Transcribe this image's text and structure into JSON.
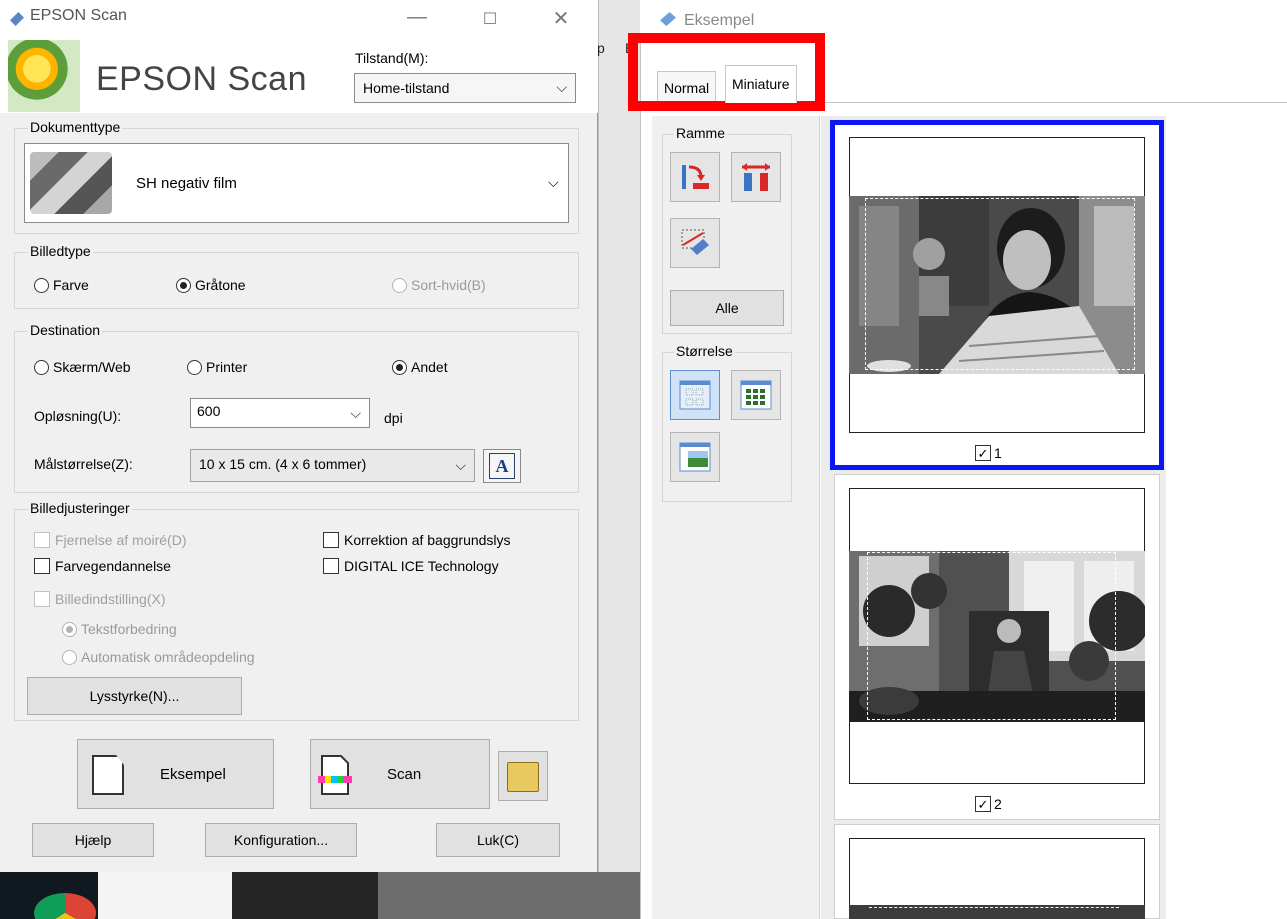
{
  "scan_window": {
    "title": "EPSON Scan",
    "logo_text": "EPSON Scan",
    "mode_label": "Tilstand(M):",
    "mode_value": "Home-tilstand",
    "document_type": {
      "group_title": "Dokumenttype",
      "value": "SH negativ film"
    },
    "image_type": {
      "group_title": "Billedtype",
      "options": [
        "Farve",
        "Gråtone",
        "Sort-hvid(B)"
      ],
      "selected": "Gråtone"
    },
    "destination": {
      "group_title": "Destination",
      "options": [
        "Skærm/Web",
        "Printer",
        "Andet"
      ],
      "selected": "Andet",
      "resolution_label": "Opløsning(U):",
      "resolution_value": "600",
      "resolution_unit": "dpi",
      "target_size_label": "Målstørrelse(Z):",
      "target_size_value": "10 x 15 cm. (4 x 6 tommer)"
    },
    "adjustments": {
      "group_title": "Billedjusteringer",
      "descreening": "Fjernelse af moiré(D)",
      "backlight_correction": "Korrektion af baggrundslys",
      "color_restoration": "Farvegendannelse",
      "digital_ice": "DIGITAL ICE Technology",
      "image_option": "Billedindstilling(X)",
      "text_enhancement": "Tekstforbedring",
      "auto_area_segmentation": "Automatisk områdeopdeling",
      "brightness_button": "Lysstyrke(N)..."
    },
    "buttons": {
      "preview": "Eksempel",
      "scan": "Scan",
      "help": "Hjælp",
      "configuration": "Konfiguration...",
      "close": "Luk(C)"
    }
  },
  "behind_window": {
    "menu_fragments": [
      "p",
      "E"
    ]
  },
  "preview_window": {
    "title": "Eksempel",
    "tabs": [
      "Normal",
      "Miniature"
    ],
    "active_tab": "Miniature",
    "frame_group_title": "Ramme",
    "all_button": "Alle",
    "size_group_title": "Størrelse",
    "thumbnails": [
      {
        "label": "1",
        "checked": true,
        "selected": true
      },
      {
        "label": "2",
        "checked": true,
        "selected": false
      },
      {
        "label": "",
        "checked": false,
        "selected": false
      }
    ],
    "highlight_color": "#ff0000",
    "selection_color": "#0a16f5"
  }
}
